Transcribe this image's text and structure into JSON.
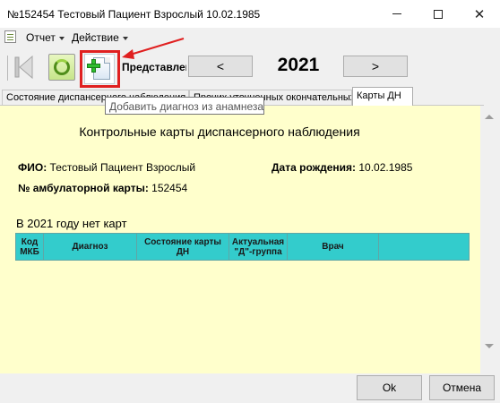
{
  "window": {
    "title": "№152454 Тестовый Пациент Взрослый 10.02.1985",
    "minimize_icon": "minimize-icon",
    "maximize_icon": "maximize-icon",
    "close_glyph": "✕"
  },
  "menu": {
    "report": "Отчет",
    "action": "Действие"
  },
  "toolbar": {
    "presentation_label": "Представлен",
    "prev": "<",
    "year": "2021",
    "next": ">",
    "add_diagnosis_tooltip": "Добавить диагноз из анамнеза"
  },
  "tabs": [
    {
      "label": "Состояние диспансерного наблюдения"
    },
    {
      "label": "Прочих уточненных окончательных диагнозов"
    },
    {
      "label": "Карты ДН"
    }
  ],
  "document": {
    "title": "Контрольные карты диспансерного наблюдения",
    "fio_label": "ФИО:",
    "fio_value": "Тестовый Пациент Взрослый",
    "dob_label": "Дата рождения:",
    "dob_value": "10.02.1985",
    "card_label": "№ амбулаторной карты:",
    "card_value": "152454",
    "no_cards": "В 2021 году нет карт"
  },
  "table": {
    "headers": [
      "Код МКБ",
      "Диагноз",
      "Состояние карты ДН",
      "Актуальная \"Д\"-группа",
      "Врач",
      ""
    ]
  },
  "footer": {
    "ok": "Ok",
    "cancel": "Отмена"
  },
  "colors": {
    "panel_bg": "#ffffcc",
    "table_header_bg": "#33cccc",
    "highlight": "#e02020"
  }
}
